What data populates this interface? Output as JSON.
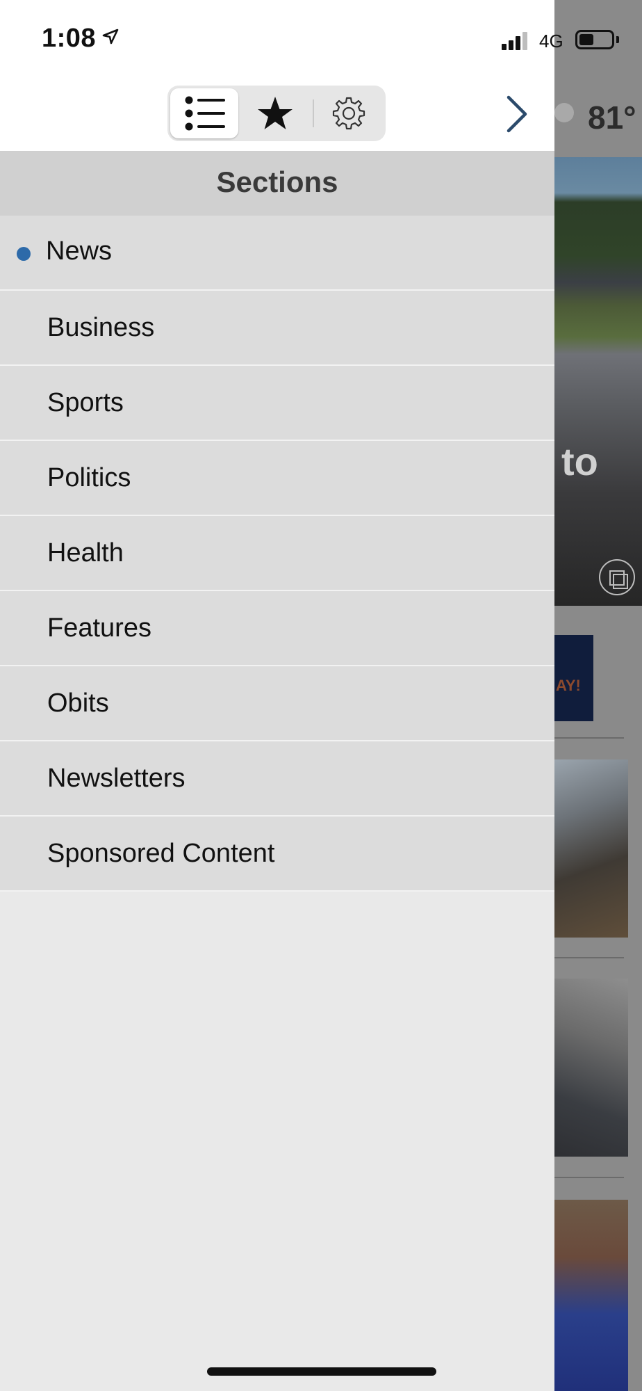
{
  "status_bar": {
    "time": "1:08",
    "network": "4G",
    "location_icon": "location-arrow-icon",
    "signal_icon": "cellular-signal-icon",
    "battery_icon": "battery-icon"
  },
  "toolbar": {
    "segments": [
      {
        "name": "sections",
        "icon": "list-icon",
        "selected": true
      },
      {
        "name": "favorites",
        "icon": "star-icon",
        "selected": false
      },
      {
        "name": "settings",
        "icon": "gear-icon",
        "selected": false
      }
    ],
    "next_icon": "chevron-right-icon"
  },
  "sections_header": {
    "title": "Sections"
  },
  "menu": {
    "items": [
      {
        "label": "News",
        "selected": true
      },
      {
        "label": "Business",
        "selected": false
      },
      {
        "label": "Sports",
        "selected": false
      },
      {
        "label": "Politics",
        "selected": false
      },
      {
        "label": "Health",
        "selected": false
      },
      {
        "label": "Features",
        "selected": false
      },
      {
        "label": "Obits",
        "selected": false
      },
      {
        "label": "Newsletters",
        "selected": false
      },
      {
        "label": "Sponsored Content",
        "selected": false
      }
    ]
  },
  "background": {
    "temperature": "81°",
    "hero_text_fragment": "to",
    "ad_text_fragment": "AY!"
  },
  "colors": {
    "accent": "#2d6aa9",
    "chevron": "#2b4a6b",
    "menu_bg": "#dcdcdc",
    "header_bg": "#d0d0d0"
  }
}
